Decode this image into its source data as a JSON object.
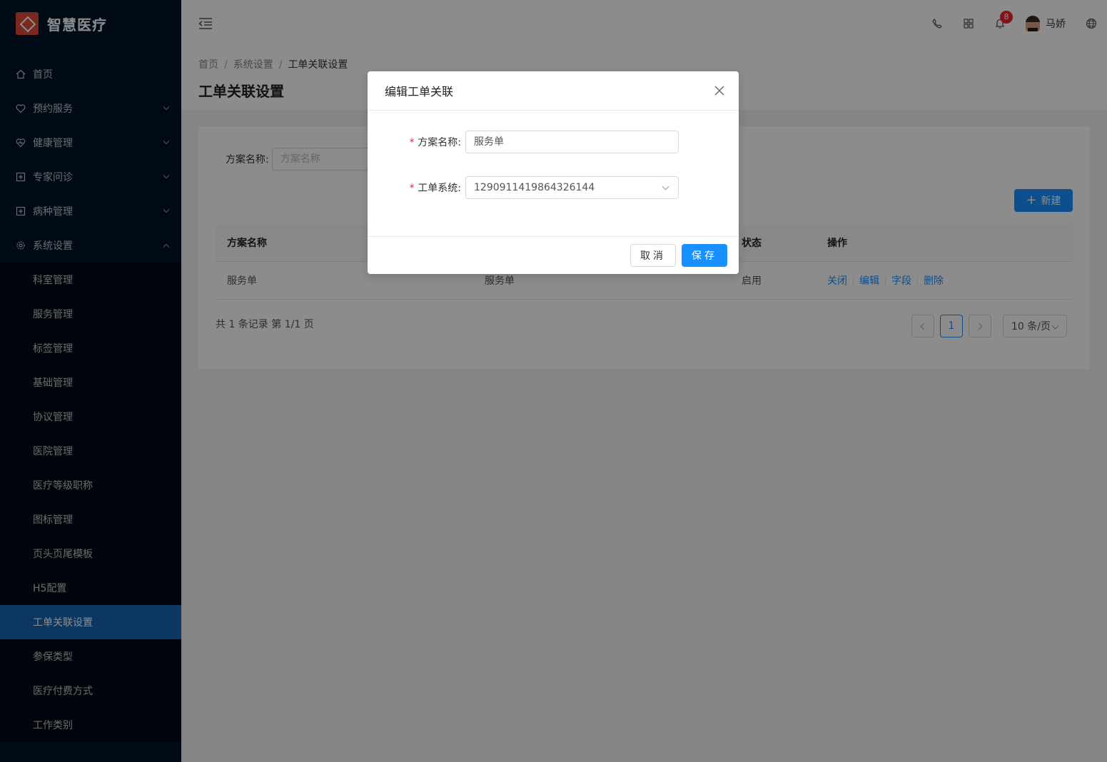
{
  "app": {
    "title": "智慧医疗"
  },
  "sidebar": {
    "items": [
      {
        "label": "首页",
        "icon": "home-icon"
      },
      {
        "label": "预约服务",
        "icon": "heart-icon"
      },
      {
        "label": "健康管理",
        "icon": "heart-pulse-icon"
      },
      {
        "label": "专家问诊",
        "icon": "plus-square-icon"
      },
      {
        "label": "病种管理",
        "icon": "plus-square-icon"
      },
      {
        "label": "系统设置",
        "icon": "gear-icon"
      }
    ],
    "submenu": [
      "科室管理",
      "服务管理",
      "标签管理",
      "基础管理",
      "协议管理",
      "医院管理",
      "医疗等级职称",
      "图标管理",
      "页头页尾模板",
      "H5配置",
      "工单关联设置",
      "参保类型",
      "医疗付费方式",
      "工作类别"
    ],
    "active_index": 10
  },
  "header": {
    "notification_count": "8",
    "user_name": "马娇"
  },
  "breadcrumb": {
    "home": "首页",
    "parent": "系统设置",
    "current": "工单关联设置"
  },
  "page": {
    "title": "工单关联设置"
  },
  "search": {
    "label": "方案名称:",
    "placeholder": "方案名称"
  },
  "toolbar": {
    "new_label": "新建"
  },
  "table": {
    "headers": [
      "方案名称",
      "",
      "状态",
      "操作"
    ],
    "rows": [
      {
        "name": "服务单",
        "system": "服务单",
        "status": "启用",
        "ops": [
          "关闭",
          "编辑",
          "字段",
          "删除"
        ]
      }
    ]
  },
  "pagination": {
    "summary": "共 1 条记录 第 1/1 页",
    "current": "1",
    "page_size": "10 条/页"
  },
  "modal": {
    "title": "编辑工单关联",
    "fields": {
      "name_label": "方案名称:",
      "name_value": "服务单",
      "system_label": "工单系统:",
      "system_value": "1290911419864326144"
    },
    "cancel_label": "取消",
    "save_label": "保存"
  },
  "colors": {
    "sidebar_bg": "#001529",
    "accent": "#1890ff",
    "active_menu": "#1765b3",
    "danger": "#f5222d"
  }
}
